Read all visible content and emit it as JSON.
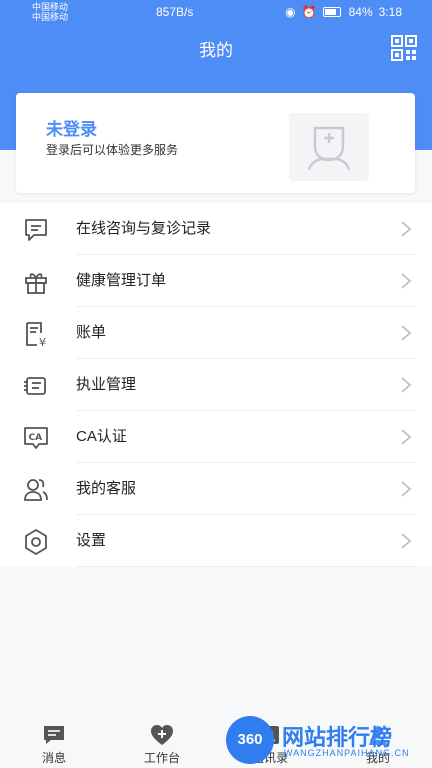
{
  "status_bar": {
    "carrier1": "中国移动",
    "carrier2": "中国移动",
    "net_speed": "857B/s",
    "battery": "84%",
    "time": "3:18"
  },
  "header": {
    "title": "我的"
  },
  "login_card": {
    "title": "未登录",
    "subtitle": "登录后可以体验更多服务"
  },
  "menu": [
    {
      "label": "在线咨询与复诊记录",
      "icon": "chat-icon"
    },
    {
      "label": "健康管理订单",
      "icon": "gift-icon"
    },
    {
      "label": "账单",
      "icon": "bill-icon"
    },
    {
      "label": "执业管理",
      "icon": "practice-icon"
    },
    {
      "label": "CA认证",
      "icon": "ca-icon"
    },
    {
      "label": "我的客服",
      "icon": "customer-service-icon"
    },
    {
      "label": "设置",
      "icon": "gear-icon"
    }
  ],
  "tabbar": {
    "messages": "消息",
    "workbench": "工作台",
    "contacts": "通讯录",
    "mine": "我的"
  },
  "watermark": {
    "badge": "360",
    "text": "网站排行榜",
    "sub": "WANGZHANPAIHANG.CN"
  },
  "colors": {
    "brand": "#4f8df6",
    "background": "#f7f8fa"
  }
}
